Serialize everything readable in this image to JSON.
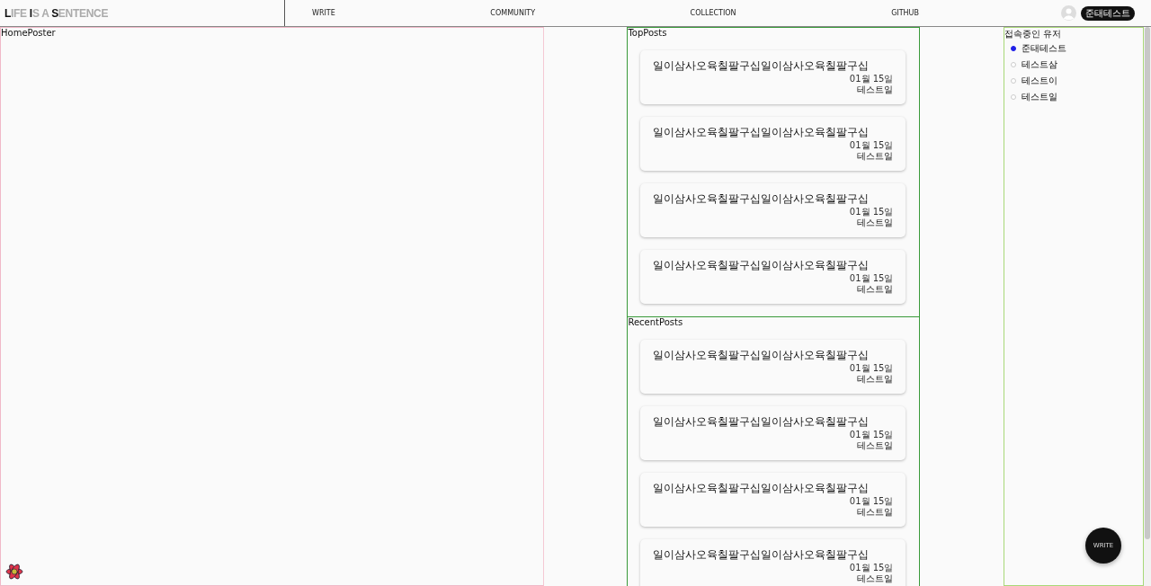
{
  "header": {
    "logo": "**L**IFE **I**S A **S**ENTENCE",
    "nav": [
      "WRITE",
      "COMMUNITY",
      "COLLECTION",
      "GITHUB"
    ],
    "user_button": "준태테스트"
  },
  "home_poster": {
    "label": "HomePoster"
  },
  "top_posts": {
    "label": "TopPosts",
    "posts": [
      {
        "title": "일이삼사오육칠팔구십일이삼사오육칠팔구십",
        "date": "01월 15일",
        "author": "테스트일"
      },
      {
        "title": "일이삼사오육칠팔구십일이삼사오육칠팔구십",
        "date": "01월 15일",
        "author": "테스트일"
      },
      {
        "title": "일이삼사오육칠팔구십일이삼사오육칠팔구십",
        "date": "01월 15일",
        "author": "테스트일"
      },
      {
        "title": "일이삼사오육칠팔구십일이삼사오육칠팔구십",
        "date": "01월 15일",
        "author": "테스트일"
      }
    ]
  },
  "recent_posts": {
    "label": "RecentPosts",
    "posts": [
      {
        "title": "일이삼사오육칠팔구십일이삼사오육칠팔구십",
        "date": "01월 15일",
        "author": "테스트일"
      },
      {
        "title": "일이삼사오육칠팔구십일이삼사오육칠팔구십",
        "date": "01월 15일",
        "author": "테스트일"
      },
      {
        "title": "일이삼사오육칠팔구십일이삼사오육칠팔구십",
        "date": "01월 15일",
        "author": "테스트일"
      },
      {
        "title": "일이삼사오육칠팔구십일이삼사오육칠팔구십",
        "date": "01월 15일",
        "author": "테스트일"
      }
    ]
  },
  "online_users": {
    "label": "접속중인 유저",
    "users": [
      {
        "name": "준태테스트",
        "online": true
      },
      {
        "name": "테스트삼",
        "online": false
      },
      {
        "name": "테스트이",
        "online": false
      },
      {
        "name": "테스트일",
        "online": false
      }
    ]
  },
  "fab": {
    "label": "WRITE"
  }
}
